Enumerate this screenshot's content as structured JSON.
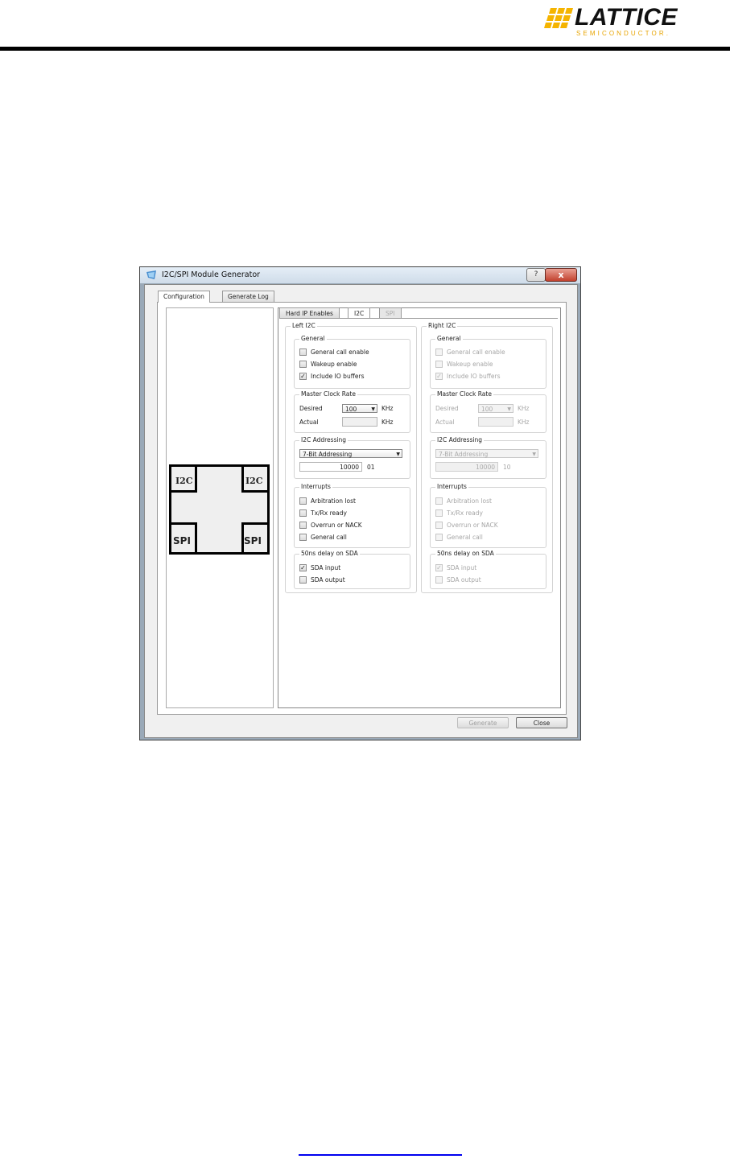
{
  "logo": {
    "word": "LATTICE",
    "sub": "SEMICONDUCTOR.",
    "colors": {
      "mark": "#f5b400",
      "text": "#111111"
    }
  },
  "window": {
    "title": "I2C/SPI Module Generator",
    "help_glyph": "?",
    "close_glyph": "x",
    "tabs": [
      "Configuration",
      "Generate Log"
    ],
    "subtabs": [
      "Hard IP Enables",
      "I2C",
      "SPI"
    ],
    "chip": {
      "top_left": "I2C",
      "top_right": "I2C",
      "bottom_left": "SPI",
      "bottom_right": "SPI"
    },
    "left": {
      "title": "Left I2C",
      "general": {
        "label": "General",
        "items": [
          {
            "label": "General call enable",
            "checked": false
          },
          {
            "label": "Wakeup  enable",
            "checked": false
          },
          {
            "label": "Include IO buffers",
            "checked": true
          }
        ]
      },
      "clock": {
        "label": "Master Clock Rate",
        "desired_label": "Desired",
        "desired_value": "100",
        "actual_label": "Actual",
        "actual_value": "",
        "unit": "KHz"
      },
      "addressing": {
        "label": "I2C Addressing",
        "mode": "7-Bit Addressing",
        "address": "10000",
        "suffix": "01"
      },
      "interrupts": {
        "label": "Interrupts",
        "items": [
          {
            "label": "Arbitration lost",
            "checked": false
          },
          {
            "label": "Tx/Rx ready",
            "checked": false
          },
          {
            "label": "Overrun or NACK",
            "checked": false
          },
          {
            "label": "General call",
            "checked": false
          }
        ]
      },
      "delay": {
        "label": "50ns delay on SDA",
        "items": [
          {
            "label": "SDA input",
            "checked": true
          },
          {
            "label": "SDA output",
            "checked": false
          }
        ]
      }
    },
    "right": {
      "title": "Right  I2C",
      "general": {
        "label": "General",
        "items": [
          {
            "label": "General call enable",
            "checked": false
          },
          {
            "label": "Wakeup  enable",
            "checked": false
          },
          {
            "label": "Include IO buffers",
            "checked": true
          }
        ]
      },
      "clock": {
        "label": "Master Clock Rate",
        "desired_label": "Desired",
        "desired_value": "100",
        "actual_label": "Actual",
        "actual_value": "",
        "unit": "KHz"
      },
      "addressing": {
        "label": "I2C Addressing",
        "mode": "7-Bit Addressing",
        "address": "10000",
        "suffix": "10"
      },
      "interrupts": {
        "label": "Interrupts",
        "items": [
          {
            "label": "Arbitration lost",
            "checked": false
          },
          {
            "label": "Tx/Rx ready",
            "checked": false
          },
          {
            "label": "Overrun or NACK",
            "checked": false
          },
          {
            "label": "General call",
            "checked": false
          }
        ]
      },
      "delay": {
        "label": "50ns delay on SDA",
        "items": [
          {
            "label": "SDA input",
            "checked": true
          },
          {
            "label": "SDA output",
            "checked": false
          }
        ]
      }
    },
    "buttons": {
      "generate": "Generate",
      "close": "Close"
    }
  },
  "icons": [
    "lattice-logo-icon",
    "app-icon",
    "help-icon",
    "close-icon",
    "dropdown-arrow-icon",
    "checkmark-icon"
  ]
}
